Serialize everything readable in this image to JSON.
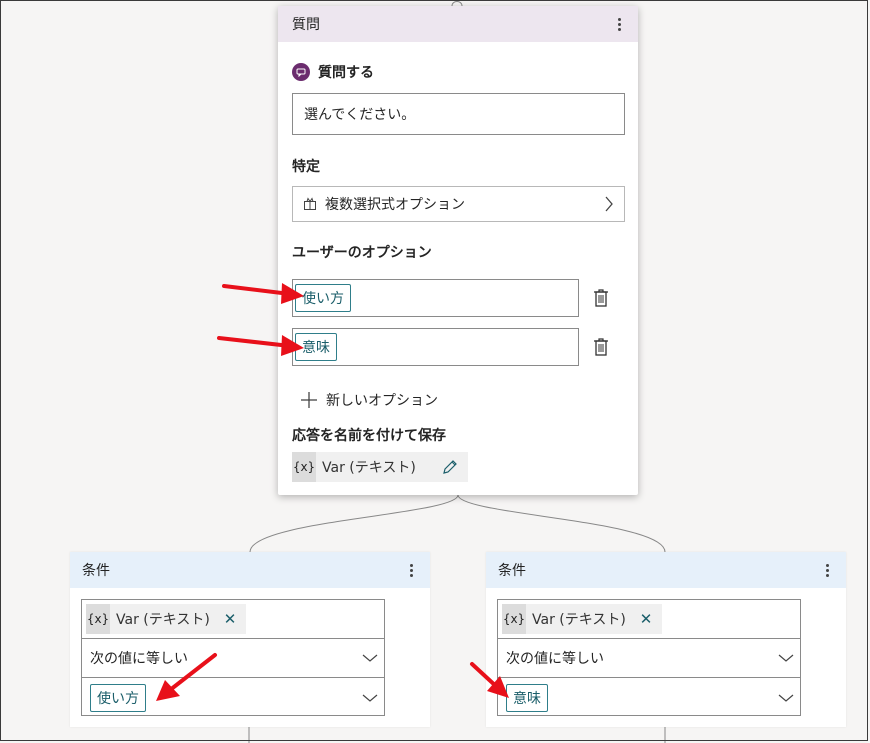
{
  "question_node": {
    "header": "質問",
    "title": "質問する",
    "prompt_value": "選んでください。",
    "identify_label": "特定",
    "identify_value": "複数選択式オプション",
    "options_label": "ユーザーのオプション",
    "options": [
      {
        "value": "使い方"
      },
      {
        "value": "意味"
      }
    ],
    "new_option_label": "新しいオプション",
    "save_label": "応答を名前を付けて保存",
    "variable": {
      "badge": "{x}",
      "text": "Var (テキスト)"
    }
  },
  "conditions": [
    {
      "header": "条件",
      "variable": {
        "badge": "{x}",
        "text": "Var (テキスト)"
      },
      "operator": "次の値に等しい",
      "value": "使い方"
    },
    {
      "header": "条件",
      "variable": {
        "badge": "{x}",
        "text": "Var (テキスト)"
      },
      "operator": "次の値に等しい",
      "value": "意味"
    }
  ],
  "colors": {
    "question_header": "#ede6ef",
    "condition_header": "#e6f0fa",
    "chip_border": "#2f7e8a",
    "annotation_arrow": "#e8101a",
    "question_icon": "#6b2c6e"
  },
  "icons": {
    "menu": "more-vertical-icon",
    "question": "chat-bubble-icon",
    "choice": "choice-list-icon",
    "chevron": "chevron-right-icon",
    "delete": "trash-icon",
    "add": "plus-icon",
    "edit": "pencil-icon",
    "remove": "close-icon",
    "dropdown": "chevron-down-icon",
    "annotation": "red-arrow-icon"
  }
}
